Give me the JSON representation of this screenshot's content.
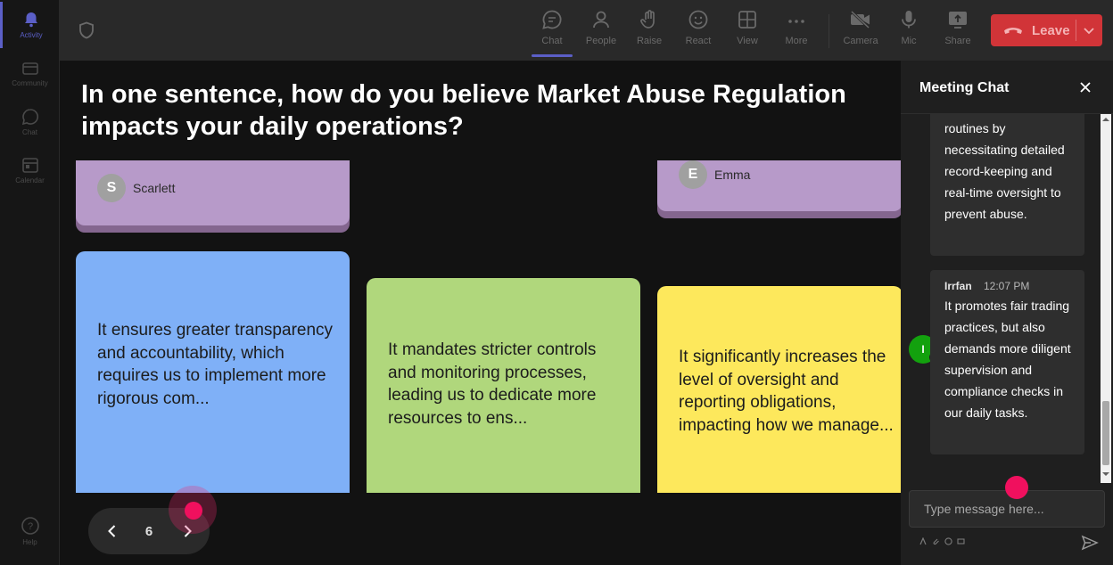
{
  "rail": {
    "items": [
      {
        "label": "Activity",
        "active": true
      },
      {
        "label": "Community"
      },
      {
        "label": "Chat"
      },
      {
        "label": "Calendar"
      }
    ],
    "help": "Help"
  },
  "toolbar": {
    "buttons": [
      {
        "label": "Chat",
        "icon": "chat-icon",
        "active": true
      },
      {
        "label": "People",
        "icon": "people-icon"
      },
      {
        "label": "Raise",
        "icon": "raise-hand-icon"
      },
      {
        "label": "React",
        "icon": "smile-icon"
      },
      {
        "label": "View",
        "icon": "grid-view-icon"
      },
      {
        "label": "More",
        "icon": "more-dots-icon"
      },
      {
        "label": "Camera",
        "icon": "camera-off-icon"
      },
      {
        "label": "Mic",
        "icon": "mic-icon"
      },
      {
        "label": "Share",
        "icon": "share-icon"
      }
    ],
    "leave_label": "Leave",
    "leave_color": "#d13438",
    "accent_color": "#5b5fc7"
  },
  "stage": {
    "question": "In one sentence, how do you believe Market Abuse Regulation impacts your daily operations?",
    "top_notes": [
      {
        "author_initial": "S",
        "author": "Scarlett",
        "color": "#b79ac9"
      },
      {
        "author_initial": "E",
        "author": "Emma",
        "color": "#b79ac9"
      }
    ],
    "notes": [
      {
        "text": "It ensures greater transparency and accountability, which requires us to implement more rigorous com...",
        "color": "#7fb0f7"
      },
      {
        "text": "It mandates stricter controls and monitoring processes, leading us to dedicate more resources to ens...",
        "color": "#b0d77c"
      },
      {
        "text": "It significantly increases the level of oversight and reporting obligations, impacting how we manage...",
        "color": "#fde85c"
      }
    ],
    "pager": {
      "page": "6"
    }
  },
  "chat": {
    "title": "Meeting Chat",
    "messages": [
      {
        "text": "routines by necessitating detailed record-keeping and real-time oversight to prevent abuse."
      },
      {
        "author": "Irrfan",
        "author_initial": "I",
        "time": "12:07 PM",
        "text": "It promotes fair trading practices, but also demands more diligent supervision and compliance checks in our daily tasks."
      }
    ],
    "input_placeholder": "Type message here...",
    "avatar_color": "#13a10e"
  }
}
